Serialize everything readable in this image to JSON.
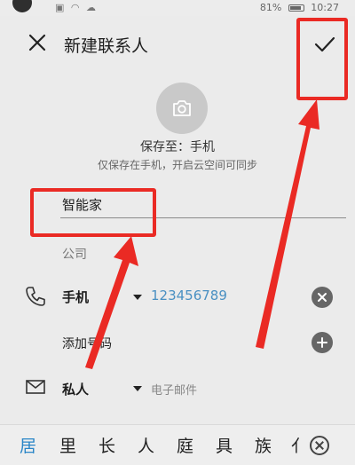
{
  "status_bar": {
    "battery_text": "81%",
    "time": "10:27"
  },
  "header": {
    "title": "新建联系人",
    "close_icon": "close-icon",
    "confirm_icon": "check-icon"
  },
  "photo": {
    "icon": "camera-icon",
    "save_to": "保存至：手机",
    "hint": "仅保存在手机，开启云空间可同步"
  },
  "form": {
    "name_value": "智能家",
    "company_placeholder": "公司",
    "phone": {
      "type": "手机",
      "value": "123456789",
      "icon": "phone-icon"
    },
    "add_number_label": "添加号码",
    "email": {
      "type": "私人",
      "placeholder": "电子邮件",
      "icon": "mail-icon"
    }
  },
  "keyboard_candidates": [
    "居",
    "里",
    "长",
    "人",
    "庭",
    "具",
    "族",
    "亻"
  ],
  "annotation_color": "#ea2a24",
  "accent_color": "#4a90c2"
}
